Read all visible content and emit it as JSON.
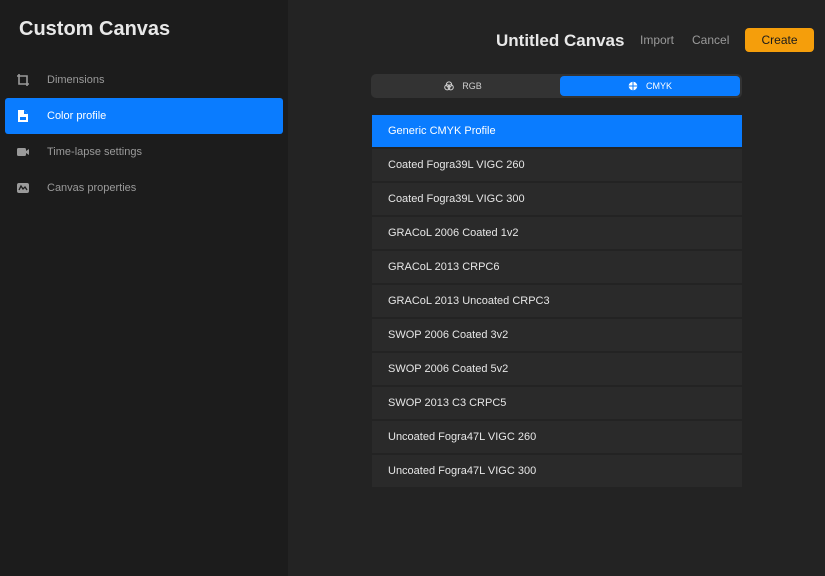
{
  "sidebar": {
    "title": "Custom Canvas",
    "items": [
      {
        "label": "Dimensions",
        "icon": "crop-dimensions-icon"
      },
      {
        "label": "Color profile",
        "icon": "color-profile-icon"
      },
      {
        "label": "Time-lapse settings",
        "icon": "video-camera-icon"
      },
      {
        "label": "Canvas properties",
        "icon": "canvas-properties-icon"
      }
    ],
    "active_index": 1
  },
  "header": {
    "canvas_name": "Untitled Canvas",
    "import_label": "Import",
    "cancel_label": "Cancel",
    "create_label": "Create"
  },
  "color_mode": {
    "options": [
      {
        "label": "RGB",
        "icon": "rgb-circles-icon"
      },
      {
        "label": "CMYK",
        "icon": "cmyk-globe-icon"
      }
    ],
    "selected": "CMYK"
  },
  "profiles": [
    "Generic CMYK Profile",
    "Coated Fogra39L VIGC 260",
    "Coated Fogra39L VIGC 300",
    "GRACoL 2006 Coated 1v2",
    "GRACoL 2013 CRPC6",
    "GRACoL 2013 Uncoated CRPC3",
    "SWOP 2006 Coated 3v2",
    "SWOP 2006 Coated 5v2",
    "SWOP 2013 C3 CRPC5",
    "Uncoated Fogra47L VIGC 260",
    "Uncoated Fogra47L VIGC 300"
  ],
  "selected_profile": "Generic CMYK Profile",
  "colors": {
    "accent": "#0a7cff",
    "create_button": "#f59e0b",
    "background": "#232323",
    "sidebar_bg": "#1c1c1c"
  }
}
